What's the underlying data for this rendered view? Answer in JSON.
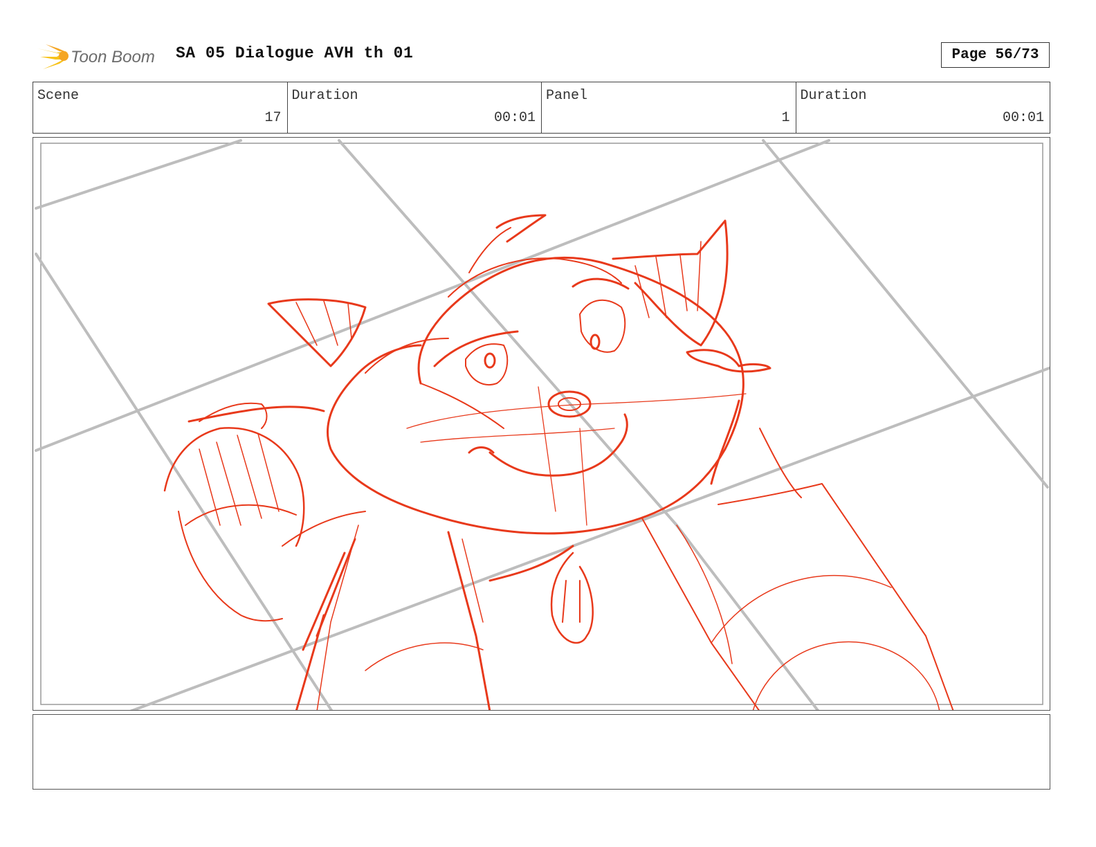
{
  "header": {
    "logo_text": "Toon Boom",
    "title": "SA 05 Dialogue AVH th 01",
    "page": "Page 56/73"
  },
  "info": {
    "scene_label": "Scene",
    "scene_value": "17",
    "duration_label": "Duration",
    "duration_value": "00:01",
    "panel_label": "Panel",
    "panel_value": "1",
    "panel_duration_label": "Duration",
    "panel_duration_value": "00:01"
  },
  "notes": {
    "text": ""
  },
  "colors": {
    "sketch": "#e8391b",
    "guide": "#bdbdbd"
  }
}
